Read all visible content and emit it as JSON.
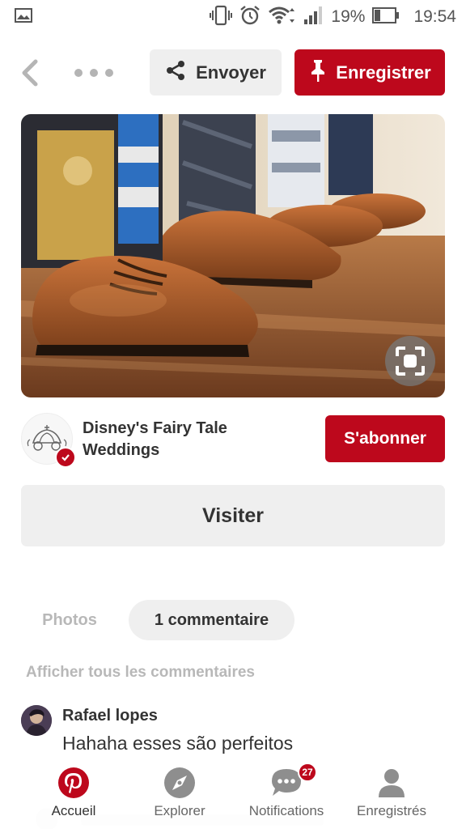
{
  "status_bar": {
    "battery": "19%",
    "time": "19:54",
    "icons": [
      "image-icon",
      "vibrate-icon",
      "alarm-icon",
      "wifi-icon",
      "signal-icon",
      "battery-icon"
    ]
  },
  "toolbar": {
    "send_label": "Envoyer",
    "save_label": "Enregistrer",
    "icons": [
      "back-chevron-icon",
      "more-dots-icon",
      "share-icon",
      "pin-icon"
    ]
  },
  "pin": {
    "image_description": "brown brogue shoes",
    "lens_icon": "visual-search-icon"
  },
  "board": {
    "title": "Disney's Fairy Tale Weddings",
    "follow_label": "S'abonner"
  },
  "visit_label": "Visiter",
  "tabs": {
    "photos": "Photos",
    "comments": "1 commentaire"
  },
  "all_comments_label": "Afficher tous les commentaires",
  "comment": {
    "author": "Rafael lopes",
    "text": "Hahaha esses são perfeitos"
  },
  "nav": {
    "items": [
      {
        "label": "Accueil",
        "icon": "pinterest-home-icon",
        "active": true
      },
      {
        "label": "Explorer",
        "icon": "compass-icon",
        "active": false
      },
      {
        "label": "Notifications",
        "icon": "chat-bubble-icon",
        "active": false
      },
      {
        "label": "Enregistrés",
        "icon": "profile-icon",
        "active": false
      }
    ],
    "notifications_badge": "27"
  },
  "colors": {
    "brand_red": "#bd081c",
    "button_gray": "#efefef",
    "muted_text": "#b8b8b8"
  }
}
